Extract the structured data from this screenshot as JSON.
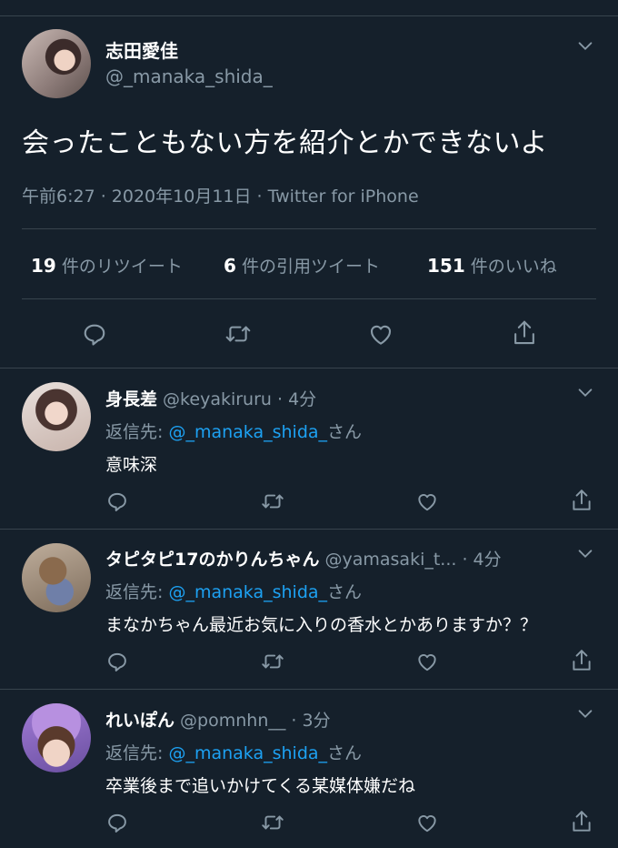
{
  "main_tweet": {
    "display_name": "志田愛佳",
    "handle": "@_manaka_shida_",
    "text": "会ったこともない方を紹介とかできないよ",
    "meta": "午前6:27 · 2020年10月11日 · Twitter for iPhone",
    "stats": {
      "retweets_count": "19",
      "retweets_label": " 件のリツイート",
      "quotes_count": "6",
      "quotes_label": " 件の引用ツイート",
      "likes_count": "151",
      "likes_label": " 件のいいね"
    }
  },
  "replies": [
    {
      "display_name": "身長差",
      "handle_time": " @keyakiruru · 4分",
      "reply_prefix": "返信先: ",
      "reply_mention": "@_manaka_shida_",
      "reply_suffix": "さん",
      "text": "意味深"
    },
    {
      "display_name": "タピタピ17のかりんちゃん",
      "handle_time": " @yamasaki_t... · 4分",
      "reply_prefix": "返信先: ",
      "reply_mention": "@_manaka_shida_",
      "reply_suffix": "さん",
      "text": "まなかちゃん最近お気に入りの香水とかありますか？？"
    },
    {
      "display_name": "れいぽん",
      "handle_time": " @pomnhn__ · 3分",
      "reply_prefix": "返信先: ",
      "reply_mention": "@_manaka_shida_",
      "reply_suffix": "さん",
      "text": "卒業後まで追いかけてくる某媒体嫌だね"
    }
  ],
  "icons": [
    "chevron-down-icon",
    "reply-icon",
    "retweet-icon",
    "like-icon",
    "share-icon"
  ],
  "colors": {
    "background": "#15202b",
    "secondary_text": "#8899a6",
    "accent": "#1da1f2",
    "divider": "#38444d"
  }
}
